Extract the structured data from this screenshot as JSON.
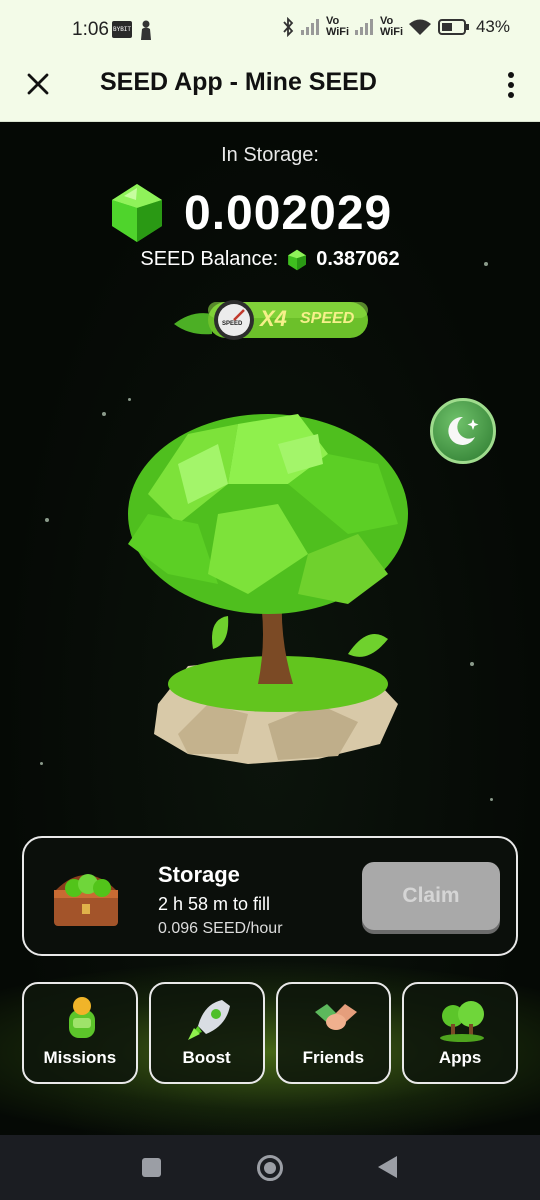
{
  "status_bar": {
    "time": "1:06",
    "badge_text": "BYBIT",
    "network_1": "Vo WiFi",
    "network_2": "Vo WiFi",
    "battery": "43%"
  },
  "header": {
    "title": "SEED App - Mine SEED",
    "close_icon": "close-icon",
    "menu_icon": "more-vertical-icon"
  },
  "main": {
    "storage_label": "In Storage:",
    "storage_amount": "0.002029",
    "balance_label": "SEED Balance:",
    "balance_value": "0.387062",
    "speed_badge": {
      "gauge_text": "SPEED",
      "multiplier": "X4",
      "label": "SPEED"
    },
    "moon_icon": "moon-stars-icon"
  },
  "storage_card": {
    "title": "Storage",
    "fill_text": "2 h 58 m to fill",
    "rate": "0.096 SEED/hour",
    "claim_label": "Claim"
  },
  "nav": [
    {
      "label": "Missions",
      "icon": "missions-icon"
    },
    {
      "label": "Boost",
      "icon": "rocket-icon"
    },
    {
      "label": "Friends",
      "icon": "handshake-icon"
    },
    {
      "label": "Apps",
      "icon": "trees-icon"
    }
  ],
  "colors": {
    "accent_green": "#5fd12c",
    "header_bg": "#f3fbe8",
    "claim_disabled": "#a9a9a9"
  }
}
